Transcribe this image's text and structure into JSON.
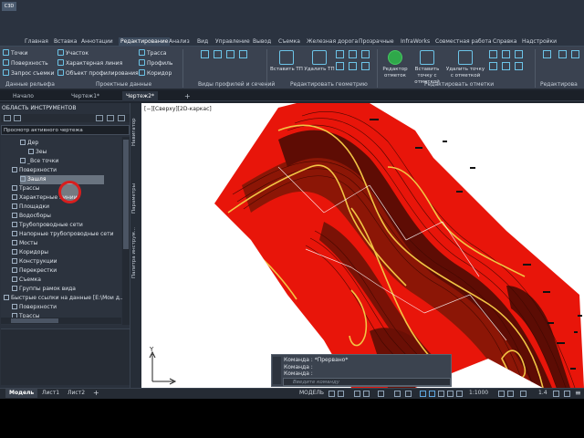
{
  "app": {
    "logo_text": "C3D"
  },
  "ribbon_tabs": [
    {
      "label": "Главная",
      "active": false
    },
    {
      "label": "Вставка",
      "active": false
    },
    {
      "label": "Аннотации",
      "active": false
    },
    {
      "label": "Редактирование",
      "active": true
    },
    {
      "label": "Анализ",
      "active": false
    },
    {
      "label": "Вид",
      "active": false
    },
    {
      "label": "Управление",
      "active": false
    },
    {
      "label": "Вывод",
      "active": false
    },
    {
      "label": "Съемка",
      "active": false
    },
    {
      "label": "Железная дорога",
      "active": false
    },
    {
      "label": "Прозрачные",
      "active": false
    },
    {
      "label": "InfraWorks",
      "active": false
    },
    {
      "label": "Совместная работа",
      "active": false
    },
    {
      "label": "Справка",
      "active": false
    },
    {
      "label": "Надстройки",
      "active": false
    }
  ],
  "ribbon": {
    "left_col1": [
      "Точки",
      "Поверхность",
      "Запрос съемки"
    ],
    "left_col2": [
      "Участок",
      "Характерная линия",
      "Объект профилирования"
    ],
    "left_col3": [
      "Трасса",
      "Профиль",
      "Коридор"
    ],
    "insert_tp": "Вставить ТП",
    "delete_tp": "Удалить ТП",
    "editor_marks": "Редактор отметок",
    "insert_point_step": "Вставить точку с отметкой",
    "delete_point_step": "Удалить точку с отметкой",
    "panel_titles": {
      "relief": "Данные рельефа",
      "design": "Проектные данные",
      "views": "Виды профилей и сечений",
      "geometry": "Редактировать геометрию",
      "elevation": "Редактировать отметки",
      "last": "Редактирова"
    }
  },
  "doc_tabs": [
    {
      "label": "Начало",
      "active": false
    },
    {
      "label": "Чертеж1*",
      "active": false
    },
    {
      "label": "Чертеж2*",
      "active": true
    }
  ],
  "toolspace": {
    "title": "ОБЛАСТЬ ИНСТРУМЕНТОВ",
    "view_select": "Просмотр активного чертежа",
    "tree": [
      {
        "label": "Дер",
        "indent": 3
      },
      {
        "label": "Зеы",
        "indent": 4
      },
      {
        "label": "_Все точки",
        "indent": 3
      },
      {
        "label": "Поверхности",
        "indent": 2
      },
      {
        "label": "Зашля",
        "indent": 3,
        "selected": true
      },
      {
        "label": "Трассы",
        "indent": 2
      },
      {
        "label": "Характерные линии",
        "indent": 2
      },
      {
        "label": "Площадки",
        "indent": 2
      },
      {
        "label": "Водосборы",
        "indent": 2
      },
      {
        "label": "Трубопроводные сети",
        "indent": 2
      },
      {
        "label": "Напорные трубопроводные сети",
        "indent": 2
      },
      {
        "label": "Мосты",
        "indent": 2
      },
      {
        "label": "Коридоры",
        "indent": 2
      },
      {
        "label": "Конструкции",
        "indent": 2
      },
      {
        "label": "Перекрестки",
        "indent": 2
      },
      {
        "label": "Съемка",
        "indent": 2
      },
      {
        "label": "Группы рамок вида",
        "indent": 2
      },
      {
        "label": "Быстрые ссылки на данные [Е:\\Мои д...",
        "indent": 1
      },
      {
        "label": "Поверхности",
        "indent": 2
      },
      {
        "label": "Трассы",
        "indent": 2
      }
    ]
  },
  "side_tabs": {
    "navigator": "Навигатор",
    "parameters": "Параметры",
    "tool_palette": "Палитра инструм..."
  },
  "canvas": {
    "view_label": "[−][Сверху][2D-каркас]",
    "axis_y": "Y"
  },
  "command": {
    "lines": [
      "Команда :  *Прервано*",
      "Команда :",
      "Команда :"
    ],
    "placeholder": "Введите команду"
  },
  "layout_tabs": [
    {
      "label": "Модель",
      "active": true
    },
    {
      "label": "Лист1",
      "active": false
    },
    {
      "label": "Лист2",
      "active": false
    }
  ],
  "status": {
    "model": "МОДЕЛЬ",
    "scale": "1:1000",
    "value": "1.4"
  },
  "colors": {
    "surface_fill": "#e8150a",
    "surface_dark": "#7a1206",
    "contour_major": "#f2c544",
    "accent_highlight": "#d81e1e"
  }
}
